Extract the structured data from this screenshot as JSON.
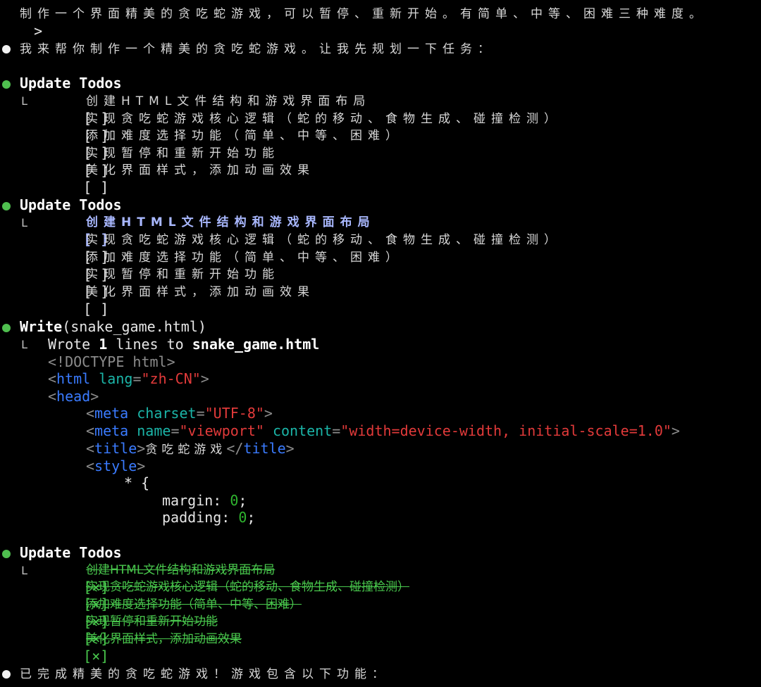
{
  "prompt": {
    "symbol": ">",
    "text": "制作一个界面精美的贪吃蛇游戏，可以暂停、重新开始。有简单、中等、困难三种难度。"
  },
  "intro": "我来帮你制作一个精美的贪吃蛇游戏。让我先规划一下任务：",
  "todos_1": {
    "title": "Update Todos",
    "items": [
      {
        "check": "[ ]",
        "label": "创建HTML文件结构和游戏界面布局"
      },
      {
        "check": "[ ]",
        "label": "实现贪吃蛇游戏核心逻辑（蛇的移动、食物生成、碰撞检测）"
      },
      {
        "check": "[ ]",
        "label": "添加难度选择功能（简单、中等、困难）"
      },
      {
        "check": "[ ]",
        "label": "实现暂停和重新开始功能"
      },
      {
        "check": "[ ]",
        "label": "美化界面样式，添加动画效果"
      }
    ]
  },
  "todos_2": {
    "title": "Update Todos",
    "items": [
      {
        "check": "[ ]",
        "label": "创建HTML文件结构和游戏界面布局"
      },
      {
        "check": "[ ]",
        "label": "实现贪吃蛇游戏核心逻辑（蛇的移动、食物生成、碰撞检测）"
      },
      {
        "check": "[ ]",
        "label": "添加难度选择功能（简单、中等、困难）"
      },
      {
        "check": "[ ]",
        "label": "实现暂停和重新开始功能"
      },
      {
        "check": "[ ]",
        "label": "美化界面样式，添加动画效果"
      }
    ]
  },
  "write": {
    "tool": "Write",
    "arg": "(snake_game.html)",
    "result_prefix": "Wrote",
    "result_count": "1",
    "result_middle": "lines to",
    "result_file": "snake_game.html",
    "code": {
      "doctype": "<!DOCTYPE html>",
      "html_open": "html",
      "html_attr": "lang",
      "html_val": "\"zh-CN\"",
      "head": "head",
      "meta": "meta",
      "charset_attr": "charset",
      "charset_val": "\"UTF-8\"",
      "name_attr": "name",
      "name_val": "\"viewport\"",
      "content_attr": "content",
      "content_val": "\"width=device-width, initial-scale=1.0\"",
      "title_tag": "title",
      "title_text": "贪吃蛇游戏",
      "style_tag": "style",
      "selector": "* {",
      "margin_prop": "margin:",
      "margin_val": "0",
      "padding_prop": "padding:",
      "padding_val": "0"
    }
  },
  "todos_3": {
    "title": "Update Todos",
    "items": [
      {
        "check": "[×]",
        "label": "创建HTML文件结构和游戏界面布局"
      },
      {
        "check": "[×]",
        "label": "实现贪吃蛇游戏核心逻辑（蛇的移动、食物生成、碰撞检测）"
      },
      {
        "check": "[×]",
        "label": "添加难度选择功能（简单、中等、困难）"
      },
      {
        "check": "[×]",
        "label": "实现暂停和重新开始功能"
      },
      {
        "check": "[×]",
        "label": "美化界面样式，添加动画效果"
      }
    ]
  },
  "final": "已完成精美的贪吃蛇游戏！游戏包含以下功能：",
  "branch_glyph": "L",
  "colors": {
    "background": "#000000",
    "bullet_green": "#4fbf4f",
    "done_green": "#49c84d",
    "active_blue": "#a9b8ff",
    "tag_blue": "#3a7bff",
    "attr_teal": "#1bb5a8",
    "string_red": "#e23a3a"
  }
}
